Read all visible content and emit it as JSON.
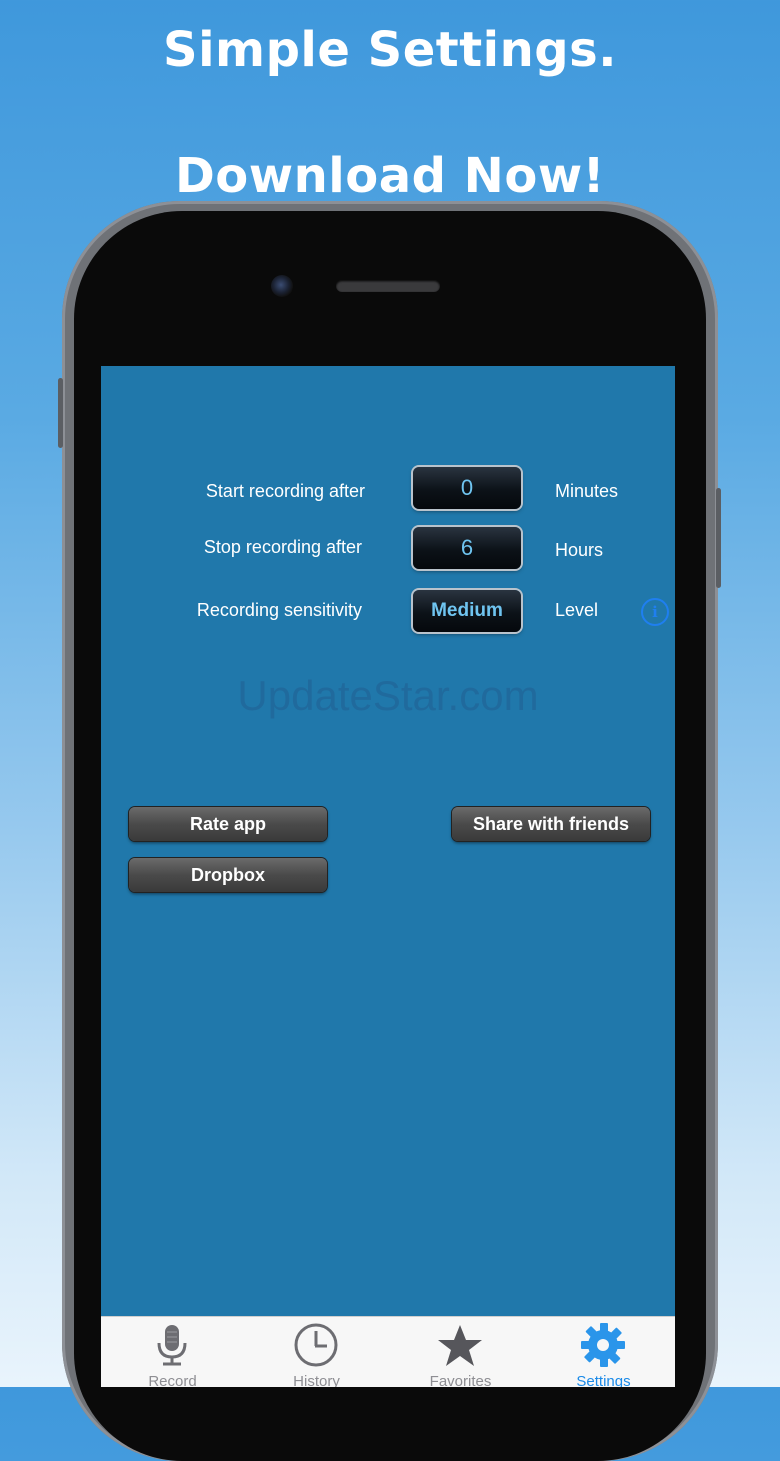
{
  "promo": {
    "headline_1": "Simple Settings.",
    "headline_2": "Download Now!"
  },
  "settings": {
    "rows": [
      {
        "label": "Start recording after",
        "value": "0",
        "unit": "Minutes"
      },
      {
        "label": "Stop recording after",
        "value": "6",
        "unit": "Hours"
      },
      {
        "label": "Recording sensitivity",
        "value": "Medium",
        "unit": "Level"
      }
    ],
    "info_icon": "info-icon"
  },
  "watermark": "UpdateStar.com",
  "buttons": {
    "rate_app": "Rate app",
    "share": "Share with friends",
    "dropbox": "Dropbox"
  },
  "tabbar": {
    "tabs": [
      {
        "label": "Record",
        "icon": "microphone-icon"
      },
      {
        "label": "History",
        "icon": "clock-icon"
      },
      {
        "label": "Favorites",
        "icon": "star-icon"
      },
      {
        "label": "Settings",
        "icon": "gear-icon",
        "active": true
      }
    ]
  },
  "colors": {
    "screen_bg": "#2078ab",
    "accent": "#1a8ae8",
    "stepper_text": "#6fc4f0"
  }
}
